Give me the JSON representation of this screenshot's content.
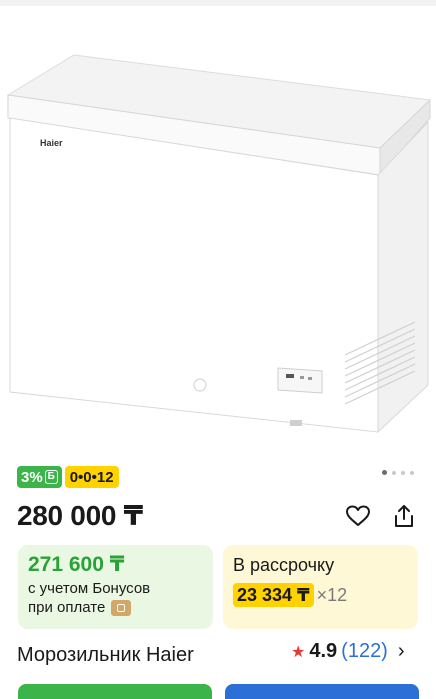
{
  "badges": {
    "bonus_percent": "3%",
    "bonus_coin": "Б",
    "installment": "0•0•12"
  },
  "gallery": {
    "brand_text": "Haier",
    "dots_count": 4,
    "active_dot": 0
  },
  "price": {
    "main": "280 000 ₸"
  },
  "bonus_card": {
    "price": "271 600 ₸",
    "line1": "с учетом Бонусов",
    "line2": "при оплате"
  },
  "installment_card": {
    "title": "В рассрочку",
    "amount": "23 334 ₸",
    "multiplier": "×12"
  },
  "product": {
    "title": "Морозильник Haier"
  },
  "rating": {
    "score": "4.9",
    "count": "(122)"
  },
  "colors": {
    "green": "#3bb54a",
    "yellow": "#ffd200",
    "blue": "#2c6fd6",
    "star": "#e53935"
  }
}
